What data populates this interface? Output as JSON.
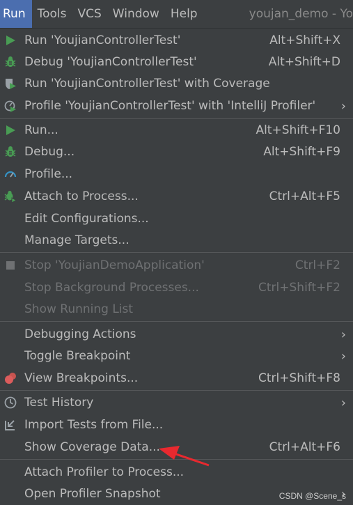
{
  "menubar": {
    "run": "Run",
    "tools": "Tools",
    "vcs": "VCS",
    "window": "Window",
    "help": "Help",
    "title": "youjan_demo - Yo"
  },
  "menu": {
    "run_config": {
      "label": "Run 'YoujianControllerTest'",
      "shortcut": "Alt+Shift+X"
    },
    "debug_config": {
      "label": "Debug 'YoujianControllerTest'",
      "shortcut": "Alt+Shift+D"
    },
    "run_coverage": {
      "label": "Run 'YoujianControllerTest' with Coverage"
    },
    "profile_config": {
      "label": "Profile 'YoujianControllerTest' with 'IntelliJ Profiler'",
      "arrow": "›"
    },
    "run": {
      "label": "Run...",
      "shortcut": "Alt+Shift+F10"
    },
    "debug": {
      "label": "Debug...",
      "shortcut": "Alt+Shift+F9"
    },
    "profile": {
      "label": "Profile..."
    },
    "attach": {
      "label": "Attach to Process...",
      "shortcut": "Ctrl+Alt+F5"
    },
    "edit_config": {
      "label": "Edit Configurations..."
    },
    "manage_targets": {
      "label": "Manage Targets..."
    },
    "stop": {
      "label": "Stop 'YoujianDemoApplication'",
      "shortcut": "Ctrl+F2"
    },
    "stop_bg": {
      "label": "Stop Background Processes...",
      "shortcut": "Ctrl+Shift+F2"
    },
    "show_running": {
      "label": "Show Running List"
    },
    "debug_actions": {
      "label": "Debugging Actions",
      "arrow": "›"
    },
    "toggle_bp": {
      "label": "Toggle Breakpoint",
      "arrow": "›"
    },
    "view_bp": {
      "label": "View Breakpoints...",
      "shortcut": "Ctrl+Shift+F8"
    },
    "test_history": {
      "label": "Test History",
      "arrow": "›"
    },
    "import_tests": {
      "label": "Import Tests from File..."
    },
    "show_coverage": {
      "label": "Show Coverage Data...",
      "shortcut": "Ctrl+Alt+F6"
    },
    "attach_profiler": {
      "label": "Attach Profiler to Process..."
    },
    "open_snapshot": {
      "label": "Open Profiler Snapshot",
      "arrow": "›"
    }
  },
  "watermark": "CSDN @Scene_s",
  "colors": {
    "background": "#3c3f41",
    "selection": "#4b6eaf",
    "run_green": "#499c54",
    "annotation_red": "#e8292f"
  }
}
